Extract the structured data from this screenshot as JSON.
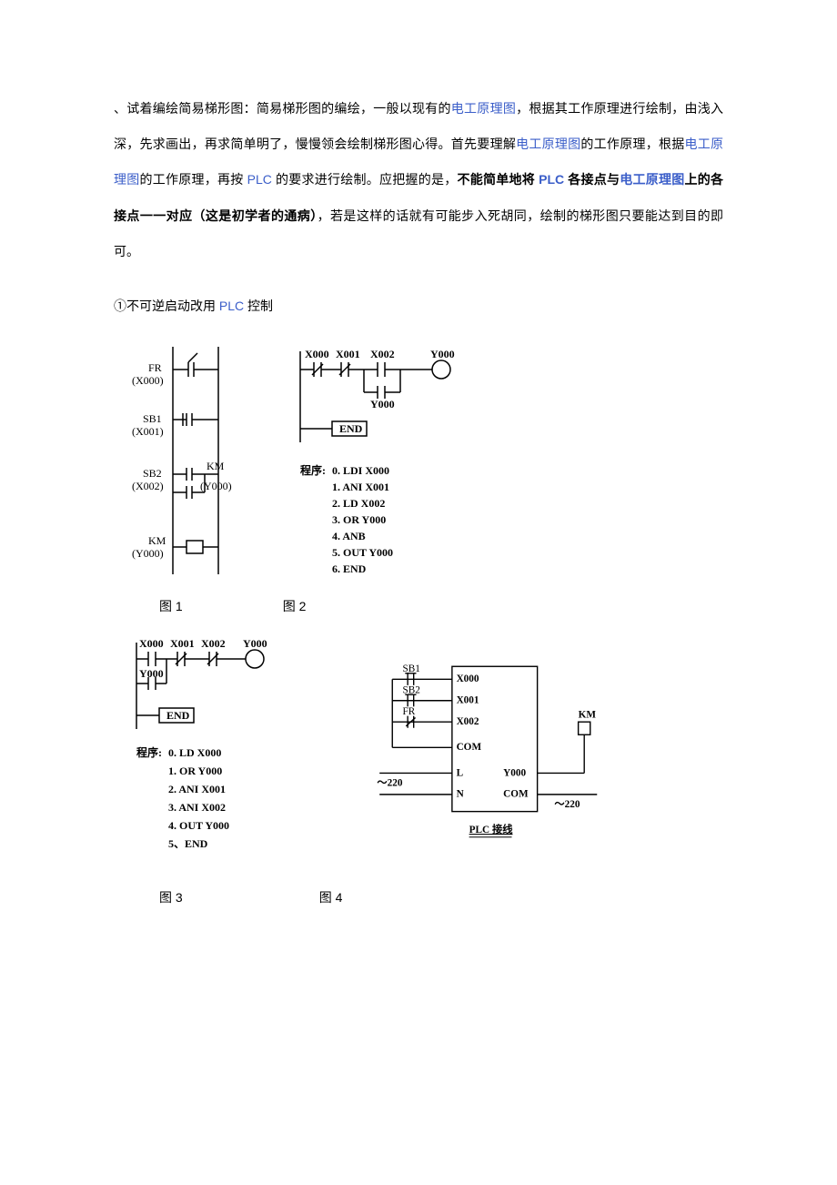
{
  "para": {
    "t1": "、试着编绘简易梯形图：简易梯形图的编绘，一般以现有的",
    "link1": "电工原理图",
    "t2": "，根据其工作原理进行绘制，由浅入深，先求画出，再求简单明了，慢慢领会绘制梯形图心得。首先要理解",
    "link2": "电工原理图",
    "t3": "的工作原理，根据",
    "link3": "电工原理图",
    "t4": "的工作原理，再按 ",
    "link4": "PLC",
    "t5": " 的要求进行绘制。应把握的是，",
    "bold1": "不能简单地将 ",
    "boldlink": "PLC",
    "bold2": " 各接点与",
    "boldlink2": "电工原理图",
    "bold3": "上的各接点一一对应（这是初学者的通病）",
    "t6": "，若是这样的话就有可能步入死胡同，绘制的梯形图只要能达到目的即可。"
  },
  "subline": {
    "t1": "①不可逆启动改用 ",
    "link": "PLC",
    "t2": " 控制"
  },
  "fig1": {
    "fr": "FR",
    "fr_x": "(X000)",
    "sb1": "SB1",
    "sb1_x": "(X001)",
    "sb2": "SB2",
    "sb2_x": "(X002)",
    "km": "KM",
    "km_y": "(Y000)",
    "km2": "KM",
    "km2_y": "(Y000)"
  },
  "fig2": {
    "x000": "X000",
    "x001": "X001",
    "x002": "X002",
    "y000": "Y000",
    "y000b": "Y000",
    "end": "END",
    "prog_label": "程序: ",
    "p0": "0. LDI X000",
    "p1": "1. ANI X001",
    "p2": "2. LD  X002",
    "p3": "3. OR  Y000",
    "p4": "4. ANB",
    "p5": "5. OUT Y000",
    "p6": "6. END"
  },
  "fig3": {
    "x000": "X000",
    "x001": "X001",
    "x002": "X002",
    "y000": "Y000",
    "y000b": "Y000",
    "end": "END",
    "prog_label": "程序: ",
    "p0": "0. LD  X000",
    "p1": "1. OR  Y000",
    "p2": "2. ANI X001",
    "p3": "3. ANI X002",
    "p4": "4. OUT Y000",
    "p5": "5、END"
  },
  "fig4": {
    "sb1": "SB1",
    "sb2": "SB2",
    "fr": "FR",
    "x000": "X000",
    "x001": "X001",
    "x002": "X002",
    "com": "COM",
    "l": "L",
    "n": "N",
    "y000": "Y000",
    "com2": "COM",
    "km": "KM",
    "v220a": "～220",
    "v220b": "～220",
    "title": "PLC 接线"
  },
  "captions": {
    "c1": "图 1",
    "c2": "图 2",
    "c3": "图 3",
    "c4": "图 4"
  }
}
